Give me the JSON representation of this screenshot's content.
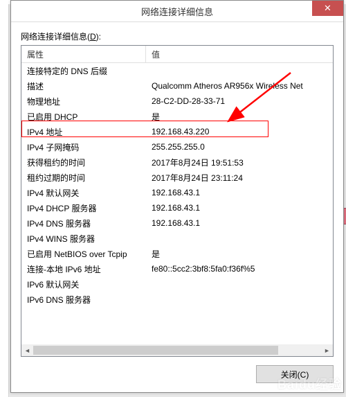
{
  "dialog": {
    "title": "网络连接详细信息",
    "section_label_prefix": "网络连接详细信息(",
    "section_label_key": "D",
    "section_label_suffix": "):",
    "columns": {
      "property": "属性",
      "value": "值"
    },
    "close_button": "关闭(C)",
    "rows": [
      {
        "prop": "连接特定的 DNS 后缀",
        "val": ""
      },
      {
        "prop": "描述",
        "val": "Qualcomm Atheros AR956x Wireless Net"
      },
      {
        "prop": "物理地址",
        "val": "28-C2-DD-28-33-71"
      },
      {
        "prop": "已启用 DHCP",
        "val": "是"
      },
      {
        "prop": "IPv4 地址",
        "val": "192.168.43.220"
      },
      {
        "prop": "IPv4 子网掩码",
        "val": "255.255.255.0"
      },
      {
        "prop": "获得租约的时间",
        "val": "2017年8月24日 19:51:53"
      },
      {
        "prop": "租约过期的时间",
        "val": "2017年8月24日 23:11:24"
      },
      {
        "prop": "IPv4 默认网关",
        "val": "192.168.43.1"
      },
      {
        "prop": "IPv4 DHCP 服务器",
        "val": "192.168.43.1"
      },
      {
        "prop": "IPv4 DNS 服务器",
        "val": "192.168.43.1"
      },
      {
        "prop": "IPv4 WINS 服务器",
        "val": ""
      },
      {
        "prop": "已启用 NetBIOS over Tcpip",
        "val": "是"
      },
      {
        "prop": "连接-本地 IPv6 地址",
        "val": "fe80::5cc2:3bf8:5fa0:f36f%5"
      },
      {
        "prop": "IPv6 默认网关",
        "val": ""
      },
      {
        "prop": "IPv6 DNS 服务器",
        "val": ""
      }
    ]
  },
  "annotation": {
    "highlight_row_index": 4,
    "arrow_color": "#ff0000"
  },
  "watermark": "Baidu经验"
}
